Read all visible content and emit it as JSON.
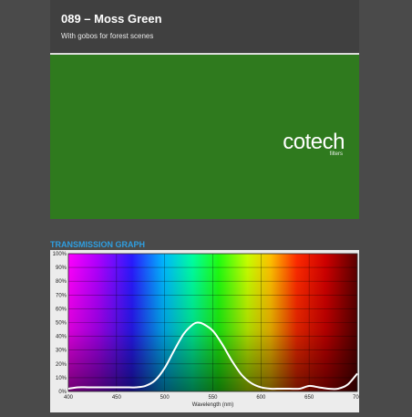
{
  "header": {
    "title": "089 – Moss Green",
    "subtitle": "With gobos for forest scenes"
  },
  "swatch": {
    "color": "#2f7a1e"
  },
  "logo": {
    "name": "cotech",
    "sub": "filters"
  },
  "graph": {
    "heading": "TRANSMISSION GRAPH",
    "heading_color": "#2f9ee0"
  },
  "chart_data": {
    "type": "line",
    "title": "TRANSMISSION GRAPH",
    "xlabel": "Wavelength (nm)",
    "ylabel": "",
    "xlim": [
      400,
      700
    ],
    "ylim": [
      0,
      100
    ],
    "x_ticks": [
      "400",
      "450",
      "500",
      "550",
      "600",
      "650",
      "700"
    ],
    "y_ticks": [
      "0%",
      "10%",
      "20%",
      "30%",
      "40%",
      "50%",
      "60%",
      "70%",
      "80%",
      "90%",
      "100%"
    ],
    "grid": true,
    "series": [
      {
        "x": [
          400,
          410,
          420,
          430,
          440,
          450,
          460,
          470,
          480,
          490,
          500,
          510,
          520,
          530,
          535,
          540,
          550,
          560,
          570,
          580,
          590,
          600,
          610,
          620,
          630,
          640,
          650,
          660,
          670,
          680,
          690,
          700
        ],
        "y": [
          2,
          3,
          3,
          3,
          3,
          3,
          3,
          3,
          4,
          8,
          17,
          30,
          42,
          49,
          50,
          49,
          44,
          34,
          22,
          12,
          6,
          3,
          2,
          2,
          2,
          2,
          4,
          3,
          2,
          2,
          5,
          13
        ]
      }
    ]
  }
}
